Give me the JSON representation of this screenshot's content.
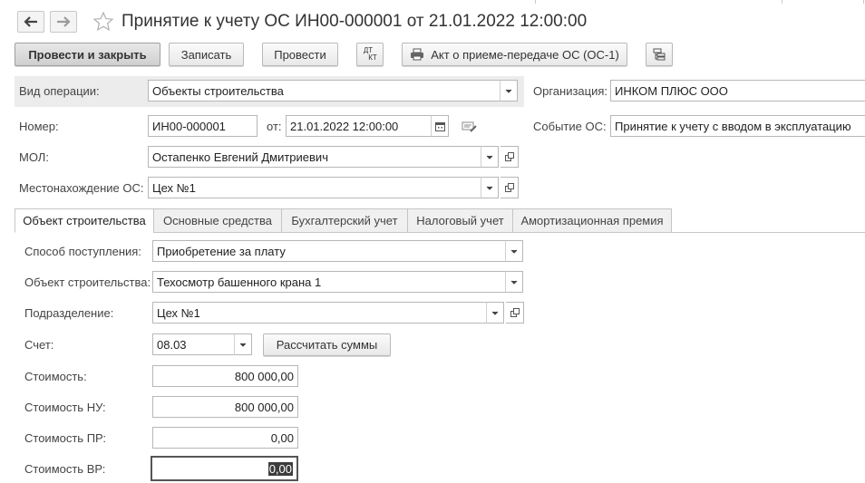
{
  "window": {
    "title": "Принятие к учету ОС ИН00-000001 от 21.01.2022 12:00:00"
  },
  "nav": {
    "back_icon": "arrow-left-icon",
    "forward_icon": "arrow-right-icon",
    "favorite_icon": "star-icon"
  },
  "toolbar": {
    "post_close_label": "Провести и закрыть",
    "save_label": "Записать",
    "post_label": "Провести",
    "dtkt_label_top": "ДТ",
    "dtkt_label_bottom": "КТ",
    "print_label": "Акт о приеме-передаче ОС (ОС-1)",
    "print_icon": "printer-icon",
    "structure_icon": "structure-icon"
  },
  "header": {
    "operation_label": "Вид операции:",
    "operation_value": "Объекты строительства",
    "org_label": "Организация:",
    "org_value": "ИНКОМ ПЛЮС ООО",
    "number_label": "Номер:",
    "number_value": "ИН00-000001",
    "date_label": "от:",
    "date_value": "21.01.2022 12:00:00",
    "event_label": "Событие ОС:",
    "event_value": "Принятие к учету с вводом в эксплуатацию",
    "mol_label": "МОЛ:",
    "mol_value": "Остапенко Евгений Дмитриевич",
    "location_label": "Местонахождение ОС:",
    "location_value": "Цех №1"
  },
  "tabs": [
    {
      "label": "Объект строительства",
      "active": true
    },
    {
      "label": "Основные средства",
      "active": false
    },
    {
      "label": "Бухгалтерский учет",
      "active": false
    },
    {
      "label": "Налоговый учет",
      "active": false
    },
    {
      "label": "Амортизационная премия",
      "active": false
    }
  ],
  "construction": {
    "method_label": "Способ поступления:",
    "method_value": "Приобретение за плату",
    "object_label": "Объект строительства:",
    "object_value": "Техосмотр башенного крана 1",
    "division_label": "Подразделение:",
    "division_value": "Цех №1",
    "account_label": "Счет:",
    "account_value": "08.03",
    "calc_label": "Рассчитать суммы",
    "cost_label": "Стоимость:",
    "cost_value": "800 000,00",
    "cost_nu_label": "Стоимость НУ:",
    "cost_nu_value": "800 000,00",
    "cost_pr_label": "Стоимость ПР:",
    "cost_pr_value": "0,00",
    "cost_vr_label": "Стоимость ВР:",
    "cost_vr_value": "0,00"
  },
  "colors": {
    "band": "#ececec",
    "border": "#b7b7b7",
    "primary_button": "#d6d6d6"
  }
}
